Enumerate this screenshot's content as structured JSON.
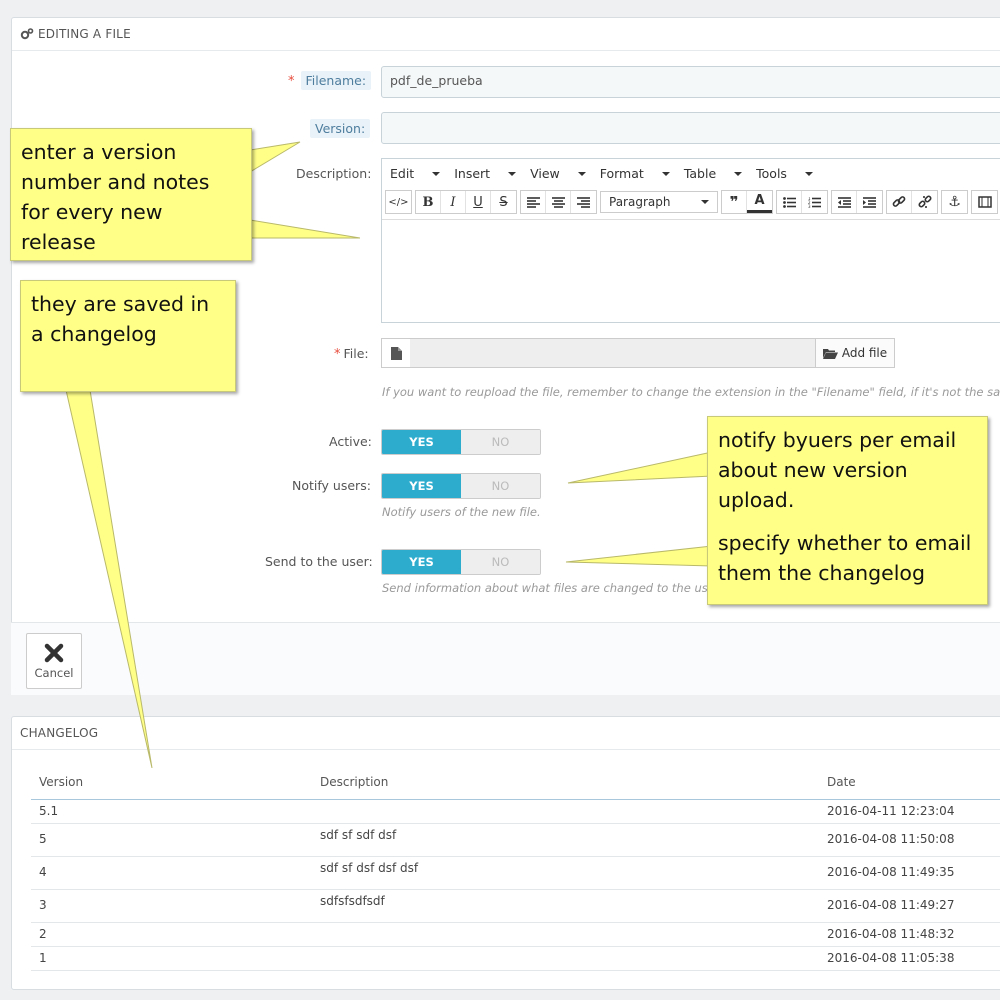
{
  "form": {
    "title": "EDITING A FILE",
    "filename_label": "Filename:",
    "filename_value": "pdf_de_prueba",
    "version_label": "Version:",
    "version_value": "",
    "description_label": "Description:",
    "file_label": "File:",
    "add_file_label": "Add file",
    "file_help": "If you want to reupload the file, remember to change the extension in the \"Filename\" field, if it's not the sa",
    "active_label": "Active:",
    "notify_label": "Notify users:",
    "notify_help": "Notify users of the new file.",
    "send_label": "Send to the user:",
    "send_help": "Send information about what files are changed to the us",
    "yes": "YES",
    "no": "NO",
    "cancel_label": "Cancel"
  },
  "editor": {
    "menu": [
      "Edit",
      "Insert",
      "View",
      "Format",
      "Table",
      "Tools"
    ],
    "block_format": "Paragraph"
  },
  "changelog": {
    "title": "CHANGELOG",
    "columns": [
      "Version",
      "Description",
      "Date"
    ],
    "rows": [
      {
        "version": "5.1",
        "description": "",
        "date": "2016-04-11 12:23:04"
      },
      {
        "version": "5",
        "description": "sdf sf sdf dsf",
        "date": "2016-04-08 11:50:08"
      },
      {
        "version": "4",
        "description": "sdf sf dsf dsf dsf",
        "date": "2016-04-08 11:49:35"
      },
      {
        "version": "3",
        "description": "sdfsfsdfsdf",
        "date": "2016-04-08 11:49:27"
      },
      {
        "version": "2",
        "description": "",
        "date": "2016-04-08 11:48:32"
      },
      {
        "version": "1",
        "description": "",
        "date": "2016-04-08 11:05:38"
      }
    ]
  },
  "notes": {
    "version_note": [
      "enter a version",
      "number and notes",
      "for every new",
      "release"
    ],
    "changelog_note": [
      "they are saved in",
      "a changelog"
    ],
    "notify_note": [
      "notify byuers per email",
      "about new version",
      "upload."
    ],
    "send_note": [
      "specify whether to email",
      "them the changelog"
    ]
  },
  "colors": {
    "accent": "#2eacce",
    "required": "#e74c3c",
    "note_bg": "#ffff88"
  }
}
